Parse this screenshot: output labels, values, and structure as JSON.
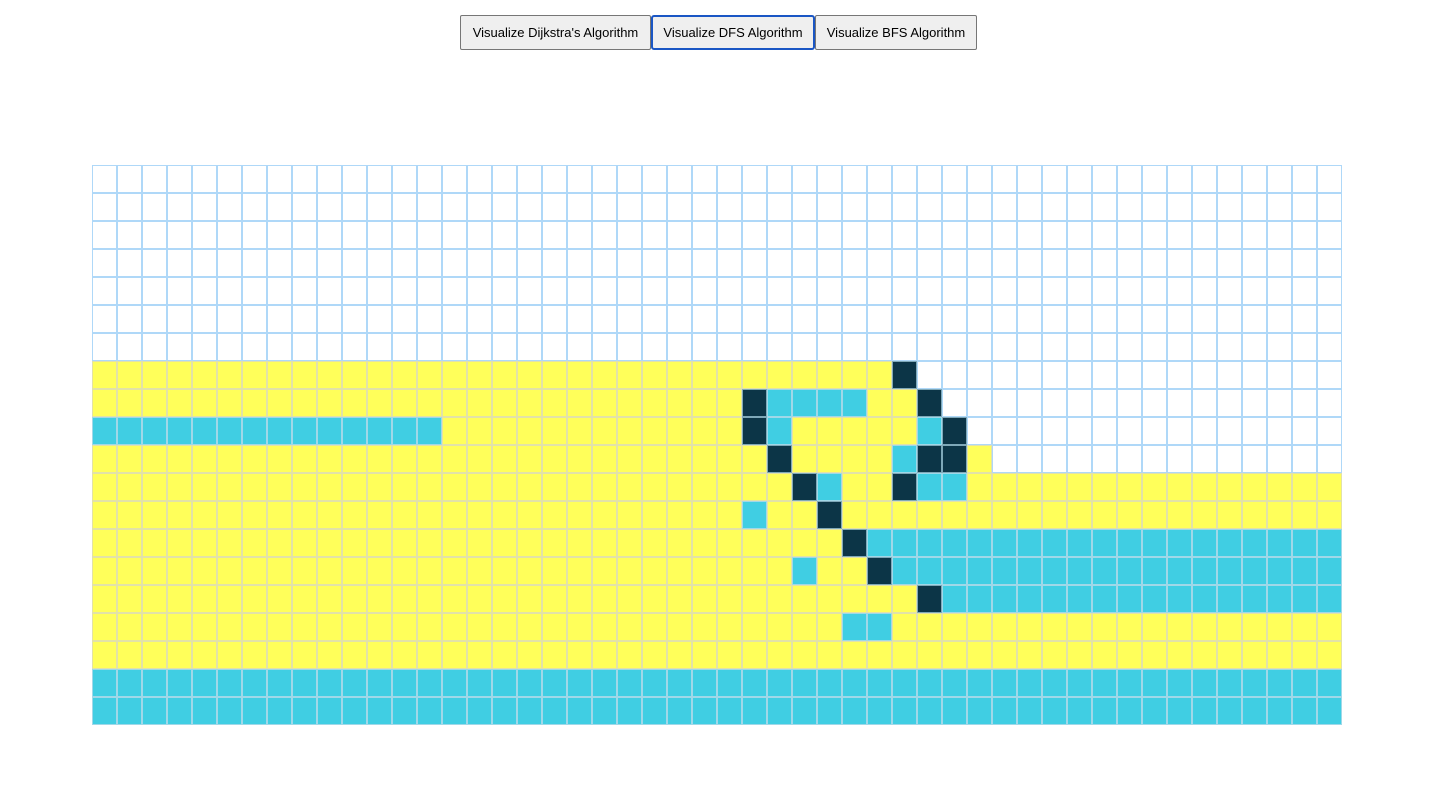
{
  "toolbar": {
    "dijkstra_label": "Visualize Dijkstra's Algorithm",
    "dfs_label": "Visualize DFS Algorithm",
    "bfs_label": "Visualize BFS Algorithm",
    "focused": "dfs"
  },
  "grid": {
    "rows": 20,
    "cols": 50,
    "legend": {
      ".": "unvisited",
      "V": "visited",
      "C": "path",
      "W": "wall"
    },
    "colors": {
      "unvisited": "#ffffff",
      "unvisited_border": "#afd8f8",
      "visited": "#ffff5a",
      "path": "#40cee3",
      "wall": "#0c3547"
    },
    "cells": [
      "..................................................",
      "..................................................",
      "..................................................",
      "..................................................",
      "..................................................",
      "..................................................",
      "..................................................",
      "VVVVVVVVVVVVVVVVVVVVVVVVVVVVVVVVW.................",
      "VVVVVVVVVVVVVVVVVVVVVVVVVVWCCCCVVW................",
      "CCCCCCCCCCCCCCVVVVVVVVVVVVWCVVVVVCW...............",
      "VVVVVVVVVVVVVVVVVVVVVVVVVVVWVVVVCWWV..............",
      "VVVVVVVVVVVVVVVVVVVVVVVVVVVVWCVVWCCVVVVVVVVVVVVVVV",
      "VVVVVVVVVVVVVVVVVVVVVVVVVVCVVWVVVVVVVVVVVVVVVVVVVV",
      "VVVVVVVVVVVVVVVVVVVVVVVVVVVVVVWCCCCCCCCCCCCCCCCCCC",
      "VVVVVVVVVVVVVVVVVVVVVVVVVVVVCVVWCCCCCCCCCCCCCCCCCC",
      "VVVVVVVVVVVVVVVVVVVVVVVVVVVVVVVVVWCCCCCCCCCCCCCCCC",
      "VVVVVVVVVVVVVVVVVVVVVVVVVVVVVVCCVVVVVVVVVVVVVVVVVV",
      "VVVVVVVVVVVVVVVVVVVVVVVVVVVVVVVVVVVVVVVVVVVVVVVVVV",
      "CCCCCCCCCCCCCCCCCCCCCCCCCCCCCCCCCCCCCCCCCCCCCCCCCC",
      "CCCCCCCCCCCCCCCCCCCCCCCCCCCCCCCCCCCCCCCCCCCCCCCCCC"
    ]
  }
}
